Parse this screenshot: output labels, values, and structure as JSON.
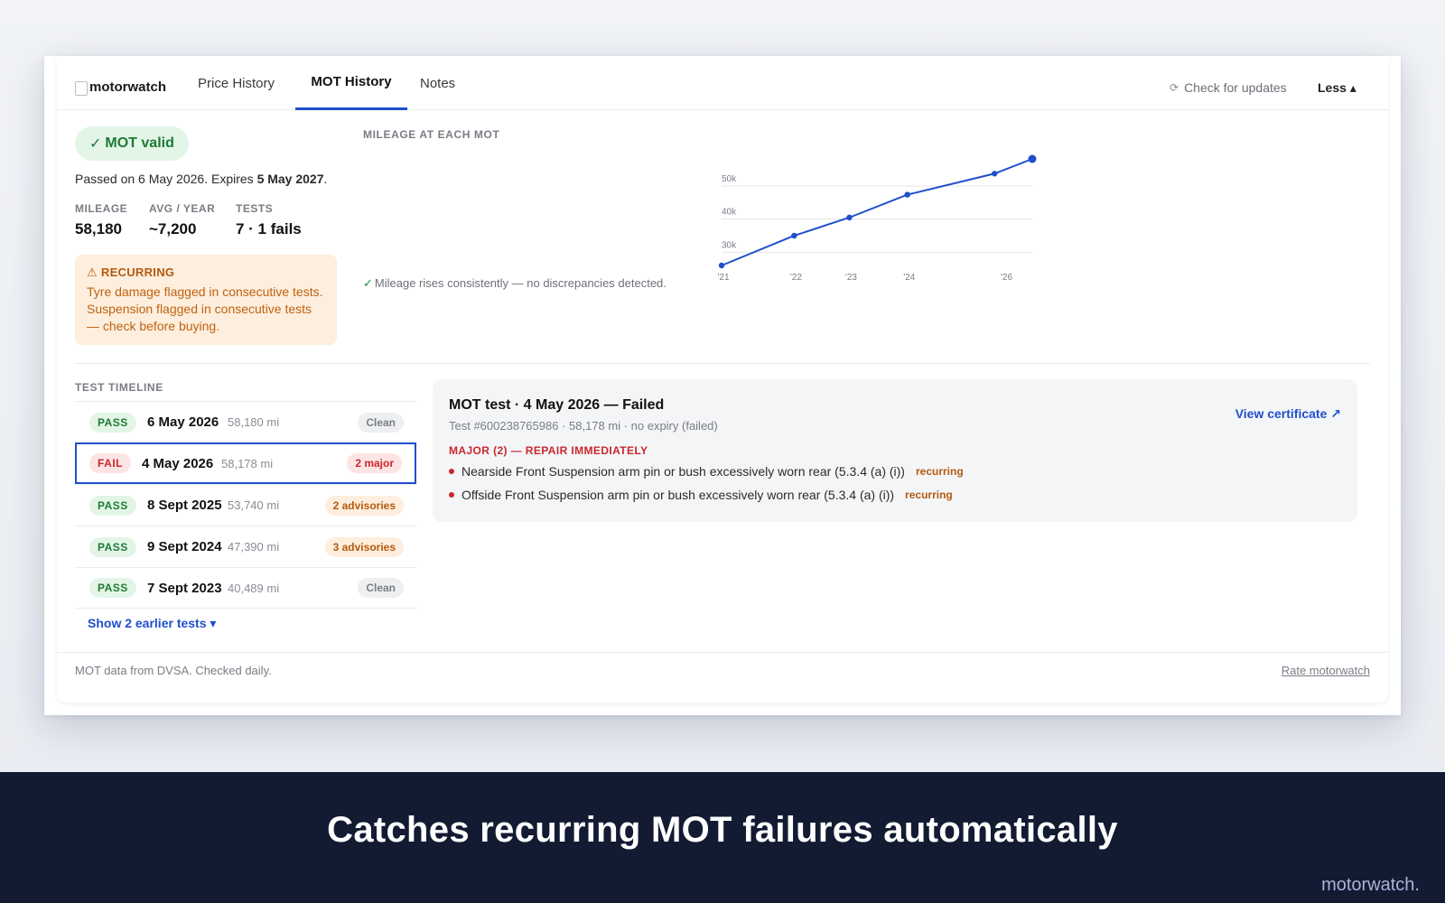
{
  "header": {
    "logo_alt": "motorwatch",
    "tabs": [
      {
        "label": "Price History"
      },
      {
        "label": "MOT History"
      },
      {
        "label": "Notes"
      }
    ],
    "check_updates": "Check for updates",
    "less": "Less ▴"
  },
  "summary": {
    "badge": "MOT valid",
    "passed_prefix": "Passed on 6 May 2026. Expires ",
    "expires": "5 May 2027",
    "passed_suffix": ".",
    "stats": [
      {
        "label": "MILEAGE",
        "value": "58,180"
      },
      {
        "label": "AVG / YEAR",
        "value": "~7,200"
      },
      {
        "label": "TESTS",
        "value": "7 · 1 fails"
      }
    ],
    "recurring": {
      "title": "RECURRING",
      "text": "Tyre damage flagged in consecutive tests. Suspension flagged in consecutive tests — check before buying."
    }
  },
  "chart": {
    "title": "MILEAGE AT EACH MOT",
    "note": "Mileage rises consistently — no discrepancies detected."
  },
  "chart_data": {
    "type": "line",
    "title": "MILEAGE AT EACH MOT",
    "xlabel": "",
    "ylabel": "",
    "x_ticks": [
      "'21",
      "'22",
      "'23",
      "'24",
      "'26"
    ],
    "y_ticks": [
      "30k",
      "40k",
      "50k"
    ],
    "x": [
      2021.0,
      2022.25,
      2023.2,
      2024.2,
      2025.7,
      2026.35
    ],
    "values": [
      26000,
      35000,
      40489,
      47390,
      53740,
      58180
    ],
    "ylim": [
      26000,
      58180
    ],
    "grid": true,
    "colors": {
      "line": "#1f4fcc"
    }
  },
  "timeline": {
    "title": "TEST TIMELINE",
    "rows": [
      {
        "result": "PASS",
        "date": "6 May 2026",
        "miles": "58,180 mi",
        "tag": "Clean",
        "kind": "clean"
      },
      {
        "result": "FAIL",
        "date": "4 May 2026",
        "miles": "58,178 mi",
        "tag": "2 major",
        "kind": "major"
      },
      {
        "result": "PASS",
        "date": "8 Sept 2025",
        "miles": "53,740 mi",
        "tag": "2 advisories",
        "kind": "adv"
      },
      {
        "result": "PASS",
        "date": "9 Sept 2024",
        "miles": "47,390 mi",
        "tag": "3 advisories",
        "kind": "adv"
      },
      {
        "result": "PASS",
        "date": "7 Sept 2023",
        "miles": "40,489 mi",
        "tag": "Clean",
        "kind": "clean"
      }
    ],
    "show_earlier": "Show 2 earlier tests ▾"
  },
  "detail": {
    "title": "MOT test · 4 May 2026 — Failed",
    "subtitle": "Test #600238765986 · 58,178 mi · no expiry (failed)",
    "view_certificate": "View certificate ↗",
    "major_heading": "MAJOR (2) — REPAIR IMMEDIATELY",
    "items": [
      {
        "text": "Nearside Front Suspension arm pin or bush excessively worn rear (5.3.4 (a) (i))",
        "tag": "recurring"
      },
      {
        "text": "Offside Front Suspension arm pin or bush excessively worn rear (5.3.4 (a) (i))",
        "tag": "recurring"
      }
    ]
  },
  "footer": {
    "left": "MOT data from DVSA. Checked daily.",
    "right": "Rate motorwatch"
  },
  "banner": {
    "headline": "Catches recurring MOT failures automatically",
    "brand": "motorwatch."
  },
  "colors": {
    "accent": "#1f4fcc",
    "pass_bg": "#e3f5e7",
    "pass_fg": "#1e7a34",
    "fail_bg": "#fde4e4",
    "fail_fg": "#c9282d",
    "warn_bg": "#fdeedd",
    "warn_fg": "#b45a10",
    "banner_bg": "#121b32"
  }
}
